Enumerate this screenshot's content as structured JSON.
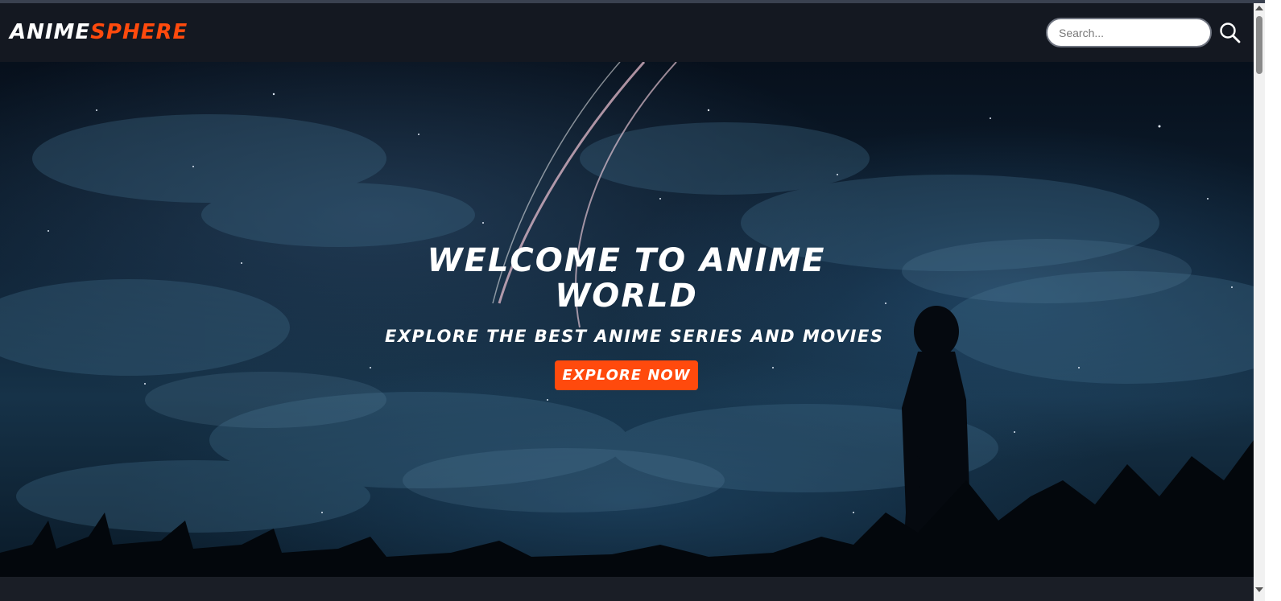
{
  "navbar": {
    "logo_part1": "ANIME",
    "logo_part2": "SPHERE",
    "search_placeholder": "Search...",
    "search_icon": "search-icon"
  },
  "hero": {
    "title": "WELCOME TO ANIME WORLD",
    "subtitle": "EXPLORE THE BEST ANIME SERIES AND MOVIES",
    "cta_label": "EXPLORE NOW"
  },
  "colors": {
    "accent": "#ff4a0d",
    "navbar_bg": "#141821",
    "text": "#ffffff"
  }
}
